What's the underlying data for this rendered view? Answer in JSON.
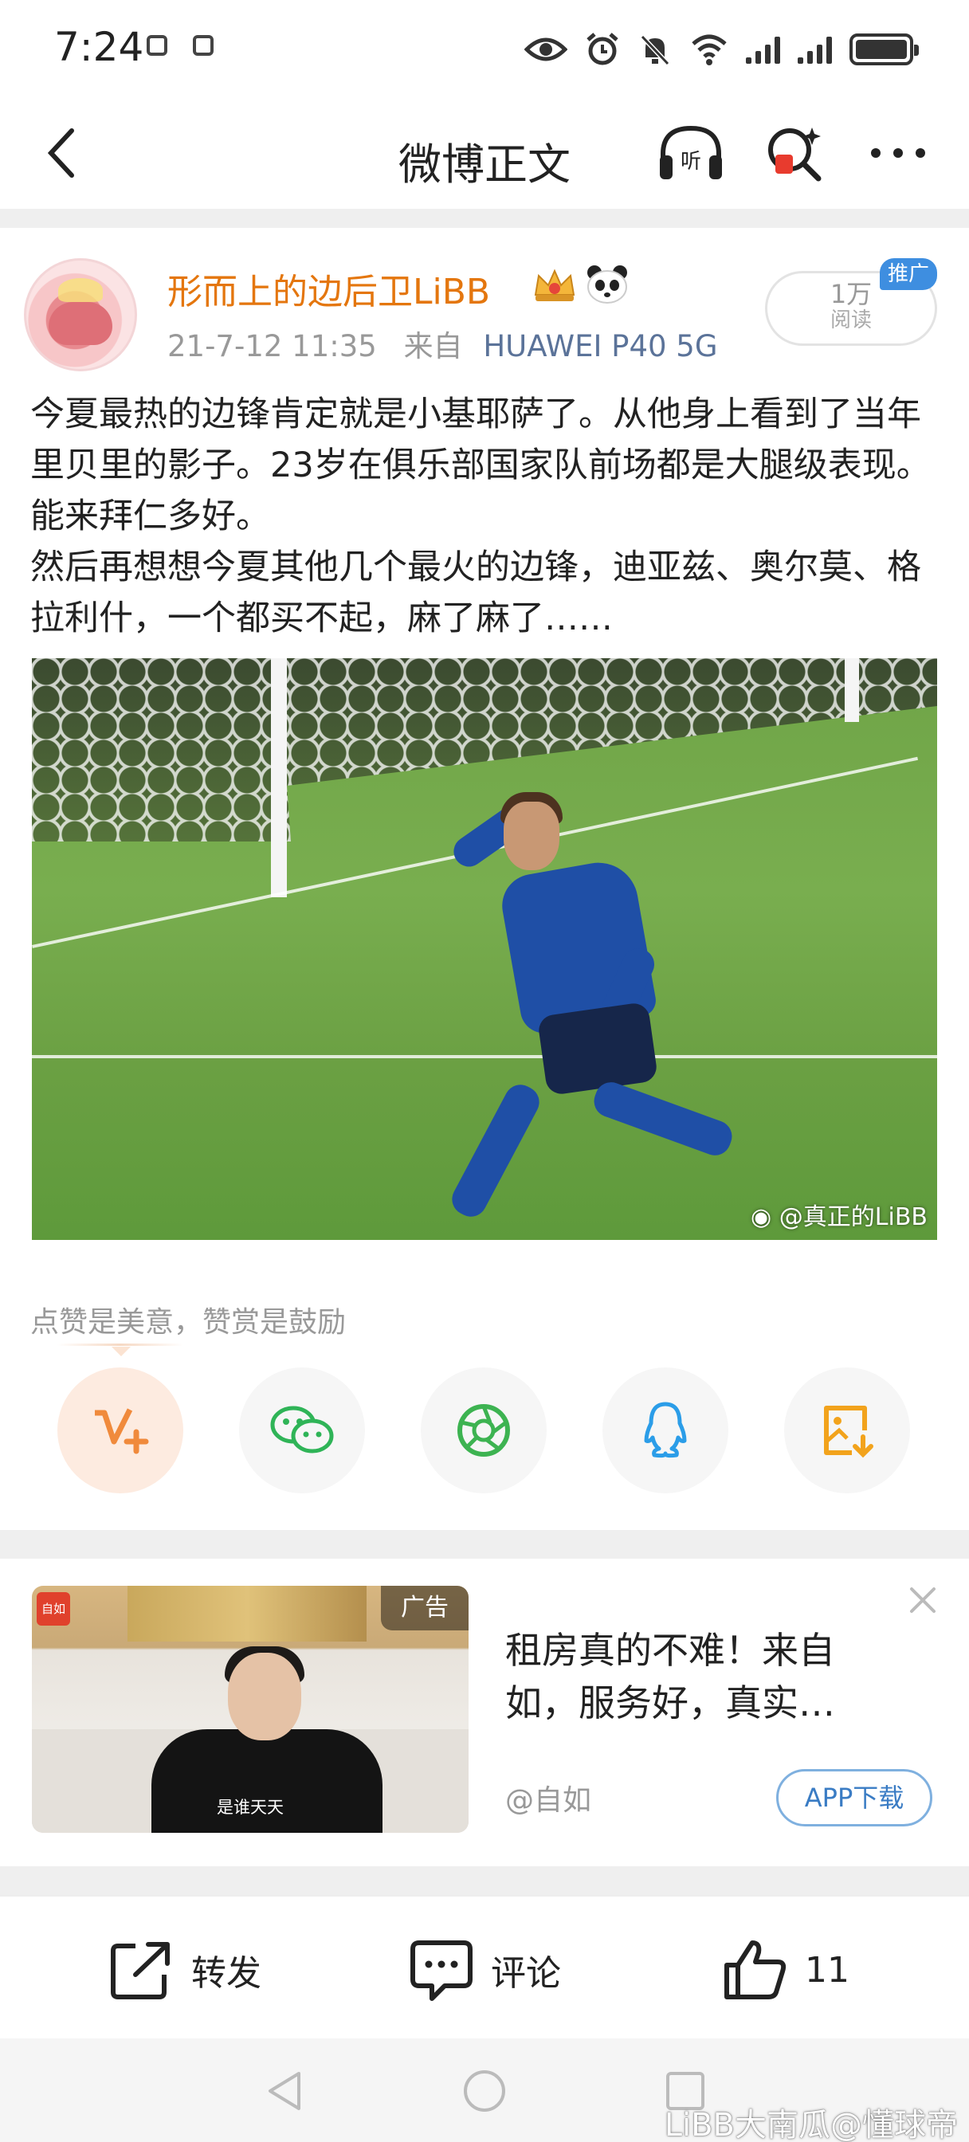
{
  "status_bar": {
    "time": "7:24"
  },
  "header": {
    "title": "微博正文"
  },
  "post": {
    "author": "形而上的边后卫LiBB",
    "timestamp": "21-7-12 11:35",
    "source_prefix": "来自",
    "device": "HUAWEI P40 5G",
    "read_count": "1万",
    "read_label": "阅读",
    "promo_tag": "推广",
    "text": "今夏最热的边锋肯定就是小基耶萨了。从他身上看到了当年里贝里的影子。23岁在俱乐部国家队前场都是大腿级表现。能来拜仁多好。\n然后再想想今夏其他几个最火的边锋，迪亚兹、奥尔莫、格拉利什，一个都买不起，麻了麻了……",
    "image_watermark": "@真正的LiBB",
    "like_hint": "点赞是美意，赞赏是鼓励"
  },
  "share_buttons": [
    {
      "icon": "reward-v-plus-icon",
      "color": "#f08a3c"
    },
    {
      "icon": "wechat-icon",
      "color": "#2fb457"
    },
    {
      "icon": "moments-aperture-icon",
      "color": "#3db351"
    },
    {
      "icon": "qq-penguin-icon",
      "color": "#2b9de8"
    },
    {
      "icon": "save-image-icon",
      "color": "#f2a31c"
    }
  ],
  "ad": {
    "label": "广告",
    "logo_text": "自如",
    "subtitle": "是谁天天",
    "title": "租房真的不难！来自如，服务好，真实…",
    "account": "@自如",
    "download_label": "APP下载"
  },
  "actions": {
    "repost_label": "转发",
    "comment_label": "评论",
    "like_count": "11"
  },
  "credit": "LiBB大南瓜@懂球帝",
  "colors": {
    "author": "#e4760e",
    "device": "#5b7399",
    "promo": "#3e8ee0",
    "ad_button": "#3a7cc4"
  }
}
